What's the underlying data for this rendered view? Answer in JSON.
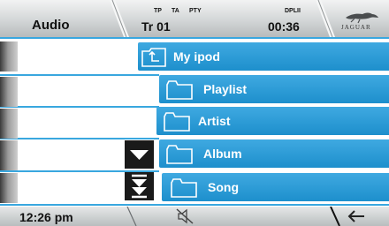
{
  "header": {
    "source_label": "Audio",
    "indicators": {
      "tp": "TP",
      "ta": "TA",
      "pty": "PTY",
      "dplii": "DPLII"
    },
    "track": "Tr 01",
    "time": "00:36",
    "logo_text": "JAGUAR"
  },
  "browser": {
    "current_folder": "My ipod",
    "items": [
      {
        "label": "Playlist"
      },
      {
        "label": "Artist"
      },
      {
        "label": "Album"
      },
      {
        "label": "Song"
      }
    ]
  },
  "footer": {
    "clock": "12:26 pm"
  },
  "icons": {
    "up_folder": "folder-up-icon",
    "folder": "folder-icon",
    "scroll_down": "chevron-down-icon",
    "page_down": "double-chevron-down-icon",
    "mute": "speaker-mute-icon",
    "back": "back-arrow-icon"
  },
  "colors": {
    "accent": "#2a9ad6",
    "row_light": "#3fa9e1",
    "row_dark": "#1d8fcc"
  }
}
